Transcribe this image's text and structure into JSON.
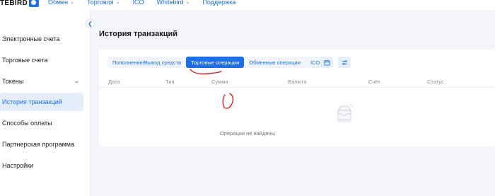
{
  "brand": {
    "logo_text": "TEBIRD"
  },
  "nav": [
    {
      "label": "Обмен",
      "has_dropdown": true
    },
    {
      "label": "Торговля",
      "has_dropdown": true
    },
    {
      "label": "ICO",
      "has_dropdown": false
    },
    {
      "label": "Whitebird",
      "has_dropdown": true
    },
    {
      "label": "Поддержка",
      "has_dropdown": false
    }
  ],
  "sidebar": {
    "items": [
      {
        "label": "Электронные счета"
      },
      {
        "label": "Торговые счета"
      },
      {
        "label": "Токены",
        "expandable": true
      },
      {
        "label": "История транзакций",
        "active": true
      },
      {
        "label": "Способы оплаты"
      },
      {
        "label": "Партнерская программа"
      },
      {
        "label": "Настройки"
      }
    ]
  },
  "page": {
    "title": "История транзакций"
  },
  "tabs": [
    {
      "label": "Пополнение/Вывод средств",
      "active": false
    },
    {
      "label": "Торговые операции",
      "active": true
    },
    {
      "label": "Обменные операции",
      "active": false
    },
    {
      "label": "ICO",
      "active": false
    }
  ],
  "table": {
    "columns": [
      "Дата",
      "Тип",
      "Сумма",
      "Валюта",
      "Счёт",
      "Статус"
    ],
    "rows": []
  },
  "empty_state": {
    "text": "Операции не найдены"
  },
  "colors": {
    "accent": "#1e6fe6",
    "active_bg": "#e3edfb",
    "annotation": "#e0201c"
  },
  "icons": {
    "calendar": "calendar-icon",
    "filter": "filter-icon",
    "collapse": "chevron-left-icon"
  }
}
